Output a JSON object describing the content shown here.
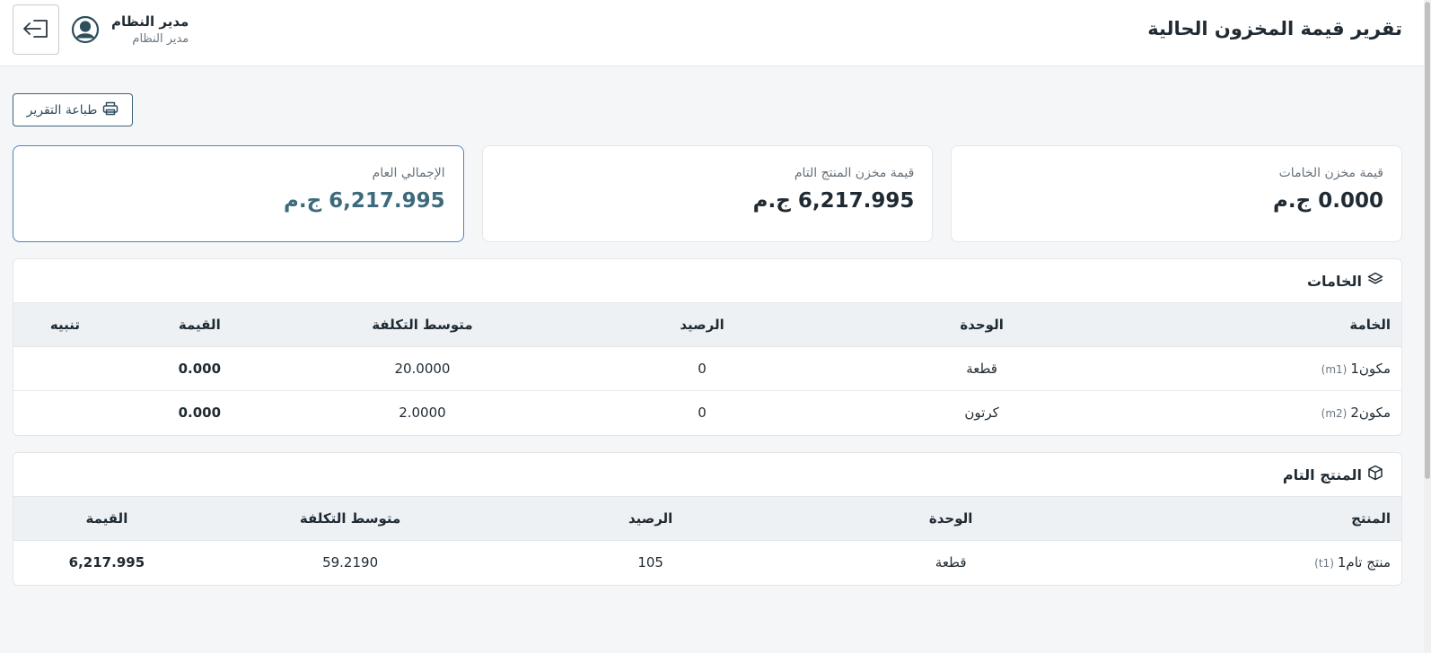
{
  "header": {
    "title": "تقرير قيمة المخزون الحالية",
    "user_name": "مدير النظام",
    "user_role": "مدير النظام"
  },
  "toolbar": {
    "print_label": "طباعة التقرير"
  },
  "cards": {
    "raw": {
      "label": "قيمة مخزن الخامات",
      "value": "0.000 ج.م"
    },
    "finished": {
      "label": "قيمة مخزن المنتج التام",
      "value": "6,217.995 ج.م"
    },
    "total": {
      "label": "الإجمالي العام",
      "value": "6,217.995 ج.م"
    }
  },
  "raw_materials": {
    "title": "الخامات",
    "headers": [
      "الخامة",
      "الوحدة",
      "الرصيد",
      "متوسط التكلفة",
      "القيمة",
      "تنبيه"
    ],
    "rows": [
      {
        "name": "مكون1",
        "code": "(m1)",
        "unit": "قطعة",
        "balance": "0",
        "avg_cost": "20.0000",
        "value": "0.000",
        "alert": ""
      },
      {
        "name": "مكون2",
        "code": "(m2)",
        "unit": "كرتون",
        "balance": "0",
        "avg_cost": "2.0000",
        "value": "0.000",
        "alert": ""
      }
    ]
  },
  "finished_products": {
    "title": "المنتج التام",
    "headers": [
      "المنتج",
      "الوحدة",
      "الرصيد",
      "متوسط التكلفة",
      "القيمة"
    ],
    "rows": [
      {
        "name": "منتج تام1",
        "code": "(t1)",
        "unit": "قطعة",
        "balance": "105",
        "avg_cost": "59.2190",
        "value": "6,217.995"
      }
    ]
  },
  "icons": {
    "logout": "logout-icon",
    "avatar": "user-circle-icon",
    "print": "printer-icon",
    "layers": "layers-icon",
    "box": "box-icon"
  },
  "colors": {
    "accent_border": "#4a86c5",
    "total_value": "#3d6b7c",
    "print_button": "#3c6478"
  }
}
